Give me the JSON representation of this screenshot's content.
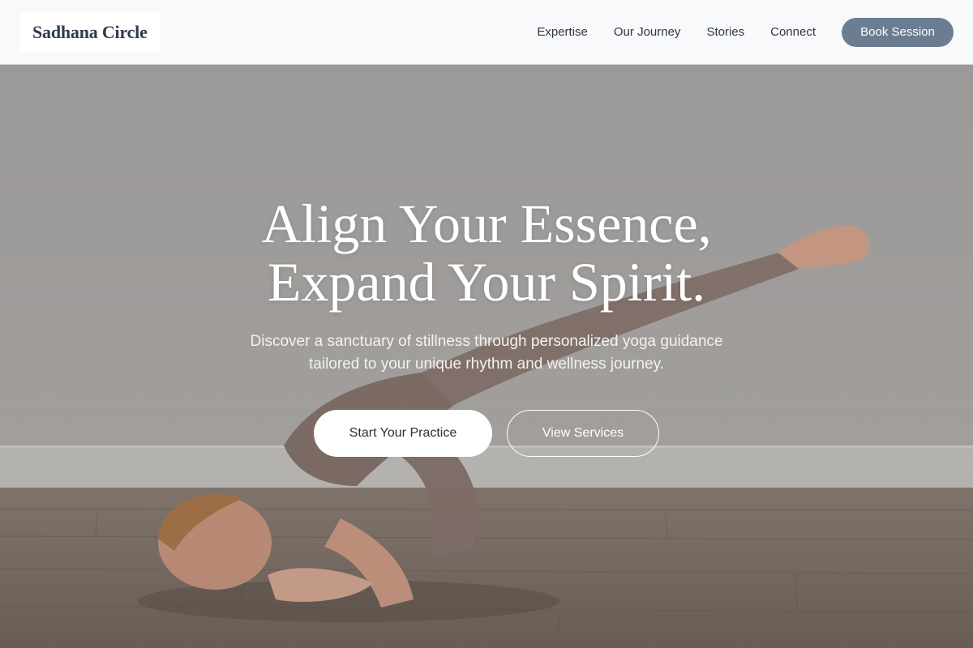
{
  "header": {
    "logo": "Sadhana Circle",
    "nav": [
      {
        "label": "Expertise"
      },
      {
        "label": "Our Journey"
      },
      {
        "label": "Stories"
      },
      {
        "label": "Connect"
      }
    ],
    "cta_label": "Book Session"
  },
  "hero": {
    "headline_line1": "Align Your Essence,",
    "headline_line2": "Expand Your Spirit.",
    "subline_line1": "Discover a sanctuary of stillness through personalized yoga guidance",
    "subline_line2": "tailored to your unique rhythm and wellness journey.",
    "primary_cta": "Start Your Practice",
    "secondary_cta": "View Services",
    "background_image": "yoga-practitioner-arm-balance-photo"
  },
  "colors": {
    "header_bg": "#f8f9fa",
    "logo_text": "#2f3b4c",
    "book_button": "#6c7d92",
    "wall": "#a7a5a3",
    "floor": "#8a7c72"
  }
}
